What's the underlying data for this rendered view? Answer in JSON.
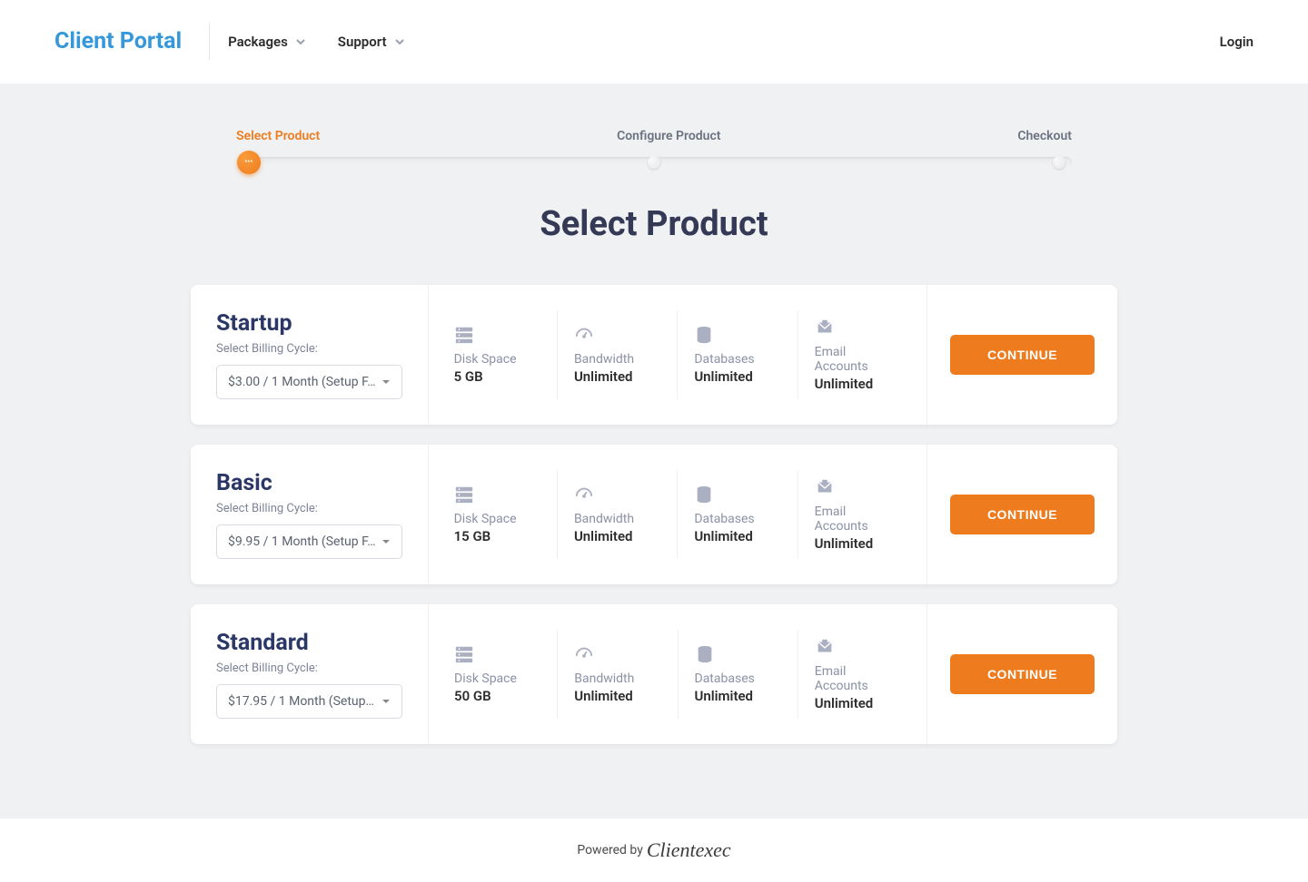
{
  "header": {
    "logo": "Client Portal",
    "nav": {
      "packages": "Packages",
      "support": "Support"
    },
    "login": "Login"
  },
  "stepper": {
    "step1": "Select Product",
    "step2": "Configure Product",
    "step3": "Checkout"
  },
  "page_title": "Select Product",
  "billing_cycle_label": "Select Billing Cycle:",
  "continue_label": "CONTINUE",
  "feature_labels": {
    "disk": "Disk Space",
    "bandwidth": "Bandwidth",
    "databases": "Databases",
    "email": "Email Accounts"
  },
  "products": [
    {
      "name": "Startup",
      "billing_selected": "$3.00 / 1 Month (Setup F…",
      "disk": "5 GB",
      "bandwidth": "Unlimited",
      "databases": "Unlimited",
      "email": "Unlimited"
    },
    {
      "name": "Basic",
      "billing_selected": "$9.95 / 1 Month (Setup F…",
      "disk": "15 GB",
      "bandwidth": "Unlimited",
      "databases": "Unlimited",
      "email": "Unlimited"
    },
    {
      "name": "Standard",
      "billing_selected": "$17.95 / 1 Month (Setup …",
      "disk": "50 GB",
      "bandwidth": "Unlimited",
      "databases": "Unlimited",
      "email": "Unlimited"
    }
  ],
  "footer": {
    "powered_by": "Powered by",
    "brand": "Clientexec"
  }
}
